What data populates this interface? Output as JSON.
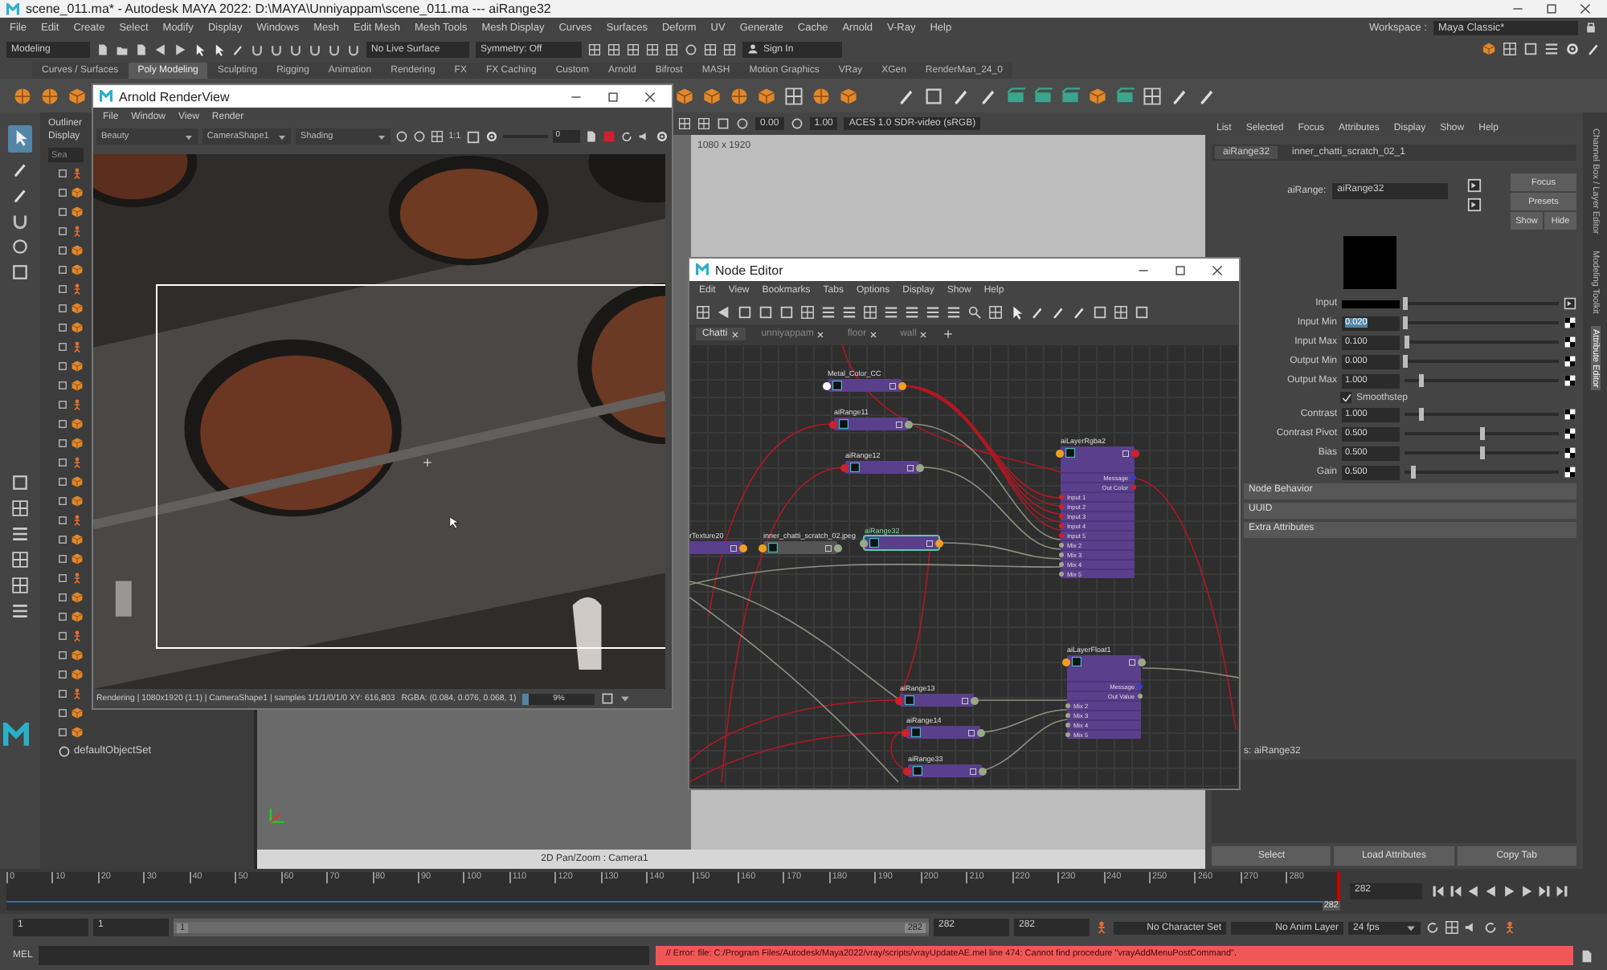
{
  "window": {
    "title": "scene_011.ma* - Autodesk MAYA 2022: D:\\MAYA\\Unniyappam\\scene_011.ma   ---   aiRange32"
  },
  "menu_bar": [
    "File",
    "Edit",
    "Create",
    "Select",
    "Modify",
    "Display",
    "Windows",
    "Mesh",
    "Edit Mesh",
    "Mesh Tools",
    "Mesh Display",
    "Curves",
    "Surfaces",
    "Deform",
    "UV",
    "Generate",
    "Cache",
    "Arnold",
    "V-Ray",
    "Help"
  ],
  "workspace": {
    "label": "Workspace :",
    "value": "Maya Classic*"
  },
  "status_line": {
    "menu_set": "Modeling",
    "live_surface": "No Live Surface",
    "symmetry": "Symmetry: Off",
    "sign_in": "Sign In"
  },
  "shelf_tabs": [
    {
      "label": "Curves / Surfaces",
      "selected": false
    },
    {
      "label": "Poly Modeling",
      "selected": true
    },
    {
      "label": "Sculpting",
      "selected": false
    },
    {
      "label": "Rigging",
      "selected": false
    },
    {
      "label": "Animation",
      "selected": false
    },
    {
      "label": "Rendering",
      "selected": false
    },
    {
      "label": "FX",
      "selected": false
    },
    {
      "label": "FX Caching",
      "selected": false
    },
    {
      "label": "Custom",
      "selected": false
    },
    {
      "label": "Arnold",
      "selected": false
    },
    {
      "label": "Bifrost",
      "selected": false
    },
    {
      "label": "MASH",
      "selected": false
    },
    {
      "label": "Motion Graphics",
      "selected": false
    },
    {
      "label": "VRay",
      "selected": false
    },
    {
      "label": "XGen",
      "selected": false
    },
    {
      "label": "RenderMan_24_0",
      "selected": false
    }
  ],
  "outliner": {
    "menu": [
      "Outliner",
      "Display"
    ],
    "search_placeholder": "Sea",
    "items": [
      "defaultObjectSet"
    ]
  },
  "viewport": {
    "exposure": "0.00",
    "gamma": "1.00",
    "view_transform": "ACES 1.0 SDR-video (sRGB)",
    "resolution": "1080 x 1920",
    "camera_label": "2D Pan/Zoom : Camera1"
  },
  "render_view": {
    "title": "Arnold RenderView",
    "menu": [
      "File",
      "Window",
      "View",
      "Render"
    ],
    "aov": "Beauty",
    "camera": "CameraShape1",
    "mode": "Shading",
    "zoom": "1:1",
    "value": "0",
    "status": "Rendering | 1080x1920 (1:1) | CameraShape1 | samples 1/1/1/0/1/0 XY: 616,803",
    "rgba": "RGBA: (0.084, 0.076, 0.068, 1)",
    "progress": {
      "level": 0.09,
      "label": "9%"
    }
  },
  "node_editor": {
    "title": "Node Editor",
    "menu": [
      "Edit",
      "View",
      "Bookmarks",
      "Tabs",
      "Options",
      "Display",
      "Show",
      "Help"
    ],
    "tabs": [
      {
        "label": "Chatti",
        "selected": true
      },
      {
        "label": "unniyappam",
        "selected": false
      },
      {
        "label": "floor",
        "selected": false
      },
      {
        "label": "wall",
        "selected": false
      }
    ],
    "nodes": [
      {
        "name": "Metal_Color_CC",
        "kind": "small",
        "selected": false,
        "ports": [
          {
            "kind": "input",
            "color": "#ffffff"
          },
          {
            "kind": "output",
            "color": "#f0a020"
          }
        ]
      },
      {
        "name": "aiRange11",
        "kind": "small",
        "selected": false,
        "ports": [
          {
            "kind": "input",
            "color": "#d0202a"
          },
          {
            "kind": "output",
            "color": "#9aa88a"
          }
        ]
      },
      {
        "name": "aiRange12",
        "kind": "small",
        "selected": false,
        "ports": [
          {
            "kind": "input",
            "color": "#d0202a"
          },
          {
            "kind": "output",
            "color": "#9aa88a"
          }
        ]
      },
      {
        "name": "aiLayerRgba2",
        "kind": "layer",
        "selected": false,
        "ports": [
          {
            "kind": "input",
            "color": "#f0a020"
          },
          {
            "kind": "output",
            "color": "#d0202a"
          },
          {
            "label": "Message",
            "kind": "output",
            "color": "#3040d0"
          },
          {
            "label": "Out Color",
            "kind": "output",
            "color": "#d0202a"
          },
          {
            "label": "Input 1",
            "kind": "input",
            "color": "#d0202a"
          },
          {
            "label": "Input 2",
            "kind": "input",
            "color": "#d0202a"
          },
          {
            "label": "Input 3",
            "kind": "input",
            "color": "#d0202a"
          },
          {
            "label": "Input 4",
            "kind": "input",
            "color": "#d0202a"
          },
          {
            "label": "Input 5",
            "kind": "input",
            "color": "#d0202a"
          },
          {
            "label": "Mix 2",
            "kind": "input",
            "color": "#9aa88a"
          },
          {
            "label": "Mix 3",
            "kind": "input",
            "color": "#9aa88a"
          },
          {
            "label": "Mix 4",
            "kind": "input",
            "color": "#9aa88a"
          },
          {
            "label": "Mix 5",
            "kind": "input",
            "color": "#9aa88a"
          }
        ]
      },
      {
        "name": "rTexture20",
        "kind": "texture",
        "selected": false,
        "ports": [
          {
            "kind": "output",
            "color": "#f0a020"
          }
        ]
      },
      {
        "name": "inner_chatti_scratch_02.jpeg",
        "kind": "file",
        "selected": false,
        "ports": [
          {
            "kind": "input",
            "color": "#f0a020"
          },
          {
            "kind": "output",
            "color": "#9aa88a"
          }
        ]
      },
      {
        "name": "aiRange32",
        "kind": "small",
        "selected": true,
        "ports": [
          {
            "kind": "input",
            "color": "#9aa88a"
          },
          {
            "kind": "output",
            "color": "#f0a020"
          }
        ]
      },
      {
        "name": "aiLayerFloat1",
        "kind": "layer",
        "selected": false,
        "ports": [
          {
            "kind": "input",
            "color": "#f0a020"
          },
          {
            "kind": "output",
            "color": "#9aa88a"
          },
          {
            "label": "Message",
            "kind": "output",
            "color": "#3040d0"
          },
          {
            "label": "Out Value",
            "kind": "output",
            "color": "#9aa88a"
          },
          {
            "label": "Mix 2",
            "kind": "input",
            "color": "#9aa88a"
          },
          {
            "label": "Mix 3",
            "kind": "input",
            "color": "#9aa88a"
          },
          {
            "label": "Mix 4",
            "kind": "input",
            "color": "#9aa88a"
          },
          {
            "label": "Mix 5",
            "kind": "input",
            "color": "#9aa88a"
          }
        ]
      },
      {
        "name": "aiRange13",
        "kind": "small",
        "selected": false,
        "ports": [
          {
            "kind": "input",
            "color": "#d0202a"
          },
          {
            "kind": "output",
            "color": "#9aa88a"
          }
        ]
      },
      {
        "name": "aiRange14",
        "kind": "small",
        "selected": false,
        "ports": [
          {
            "kind": "input",
            "color": "#d0202a"
          },
          {
            "kind": "output",
            "color": "#9aa88a"
          }
        ]
      },
      {
        "name": "aiRange33",
        "kind": "small",
        "selected": false,
        "ports": [
          {
            "kind": "input",
            "color": "#d0202a"
          },
          {
            "kind": "output",
            "color": "#9aa88a"
          }
        ]
      }
    ]
  },
  "attribute_editor": {
    "menu": [
      "List",
      "Selected",
      "Focus",
      "Attributes",
      "Display",
      "Show",
      "Help"
    ],
    "tabs": [
      {
        "label": "aiRange32",
        "selected": true
      },
      {
        "label": "inner_chatti_scratch_02_1",
        "selected": false
      }
    ],
    "node_label": "aiRange:",
    "node_name": "aiRange32",
    "buttons": [
      "Focus",
      "Presets",
      "Show",
      "Hide"
    ],
    "attributes": [
      {
        "kind": "color",
        "label": "Input",
        "level": 0.0
      },
      {
        "kind": "slider",
        "label": "Input Min",
        "value": "0.020",
        "text_selected": true,
        "level": 0.0
      },
      {
        "kind": "slider",
        "label": "Input Max",
        "value": "0.100",
        "text_selected": false,
        "level": 0.01
      },
      {
        "kind": "slider",
        "label": "Output Min",
        "value": "0.000",
        "text_selected": false,
        "level": 0.0
      },
      {
        "kind": "slider",
        "label": "Output Max",
        "value": "1.000",
        "text_selected": false,
        "level": 0.1
      },
      {
        "kind": "checkbox",
        "label": "Smoothstep",
        "checked": true
      },
      {
        "kind": "slider",
        "label": "Contrast",
        "value": "1.000",
        "text_selected": false,
        "level": 0.1
      },
      {
        "kind": "slider",
        "label": "Contrast Pivot",
        "value": "0.500",
        "text_selected": false,
        "level": 0.5
      },
      {
        "kind": "slider",
        "label": "Bias",
        "value": "0.500",
        "text_selected": false,
        "level": 0.5
      },
      {
        "kind": "slider",
        "label": "Gain",
        "value": "0.500",
        "text_selected": false,
        "level": 0.05
      }
    ],
    "sections": [
      "Node Behavior",
      "UUID",
      "Extra Attributes"
    ],
    "notes_label": "s: aiRange32",
    "bottom_buttons": [
      "Select",
      "Load Attributes",
      "Copy Tab"
    ]
  },
  "side_tabs": [
    {
      "label": "Channel Box / Layer Editor",
      "selected": false
    },
    {
      "label": "Modeling Toolkit",
      "selected": false
    },
    {
      "label": "Attribute Editor",
      "selected": true
    }
  ],
  "time_slider": {
    "ticks": [
      "0",
      "10",
      "20",
      "30",
      "40",
      "50",
      "60",
      "70",
      "80",
      "90",
      "100",
      "110",
      "120",
      "130",
      "140",
      "150",
      "160",
      "170",
      "180",
      "190",
      "200",
      "210",
      "220",
      "230",
      "240",
      "250",
      "260",
      "270",
      "280"
    ],
    "current_marker": "282",
    "current_frame": "282",
    "level": 1.0
  },
  "range_slider": {
    "level": 1.0,
    "start": "1",
    "range_start": "1",
    "slider_start": "1",
    "slider_end": "282",
    "range_end": "282",
    "end": "282",
    "character_set": "No Character Set",
    "anim_layer": "No Anim Layer",
    "fps": "24 fps"
  },
  "command_line": {
    "label": "MEL",
    "message": "// Error: file: C:/Program Files/Autodesk/Maya2022/vray/scripts/vrayUpdateAE.mel line 474: Cannot find procedure \"vrayAddMenuPostCommand\"."
  }
}
